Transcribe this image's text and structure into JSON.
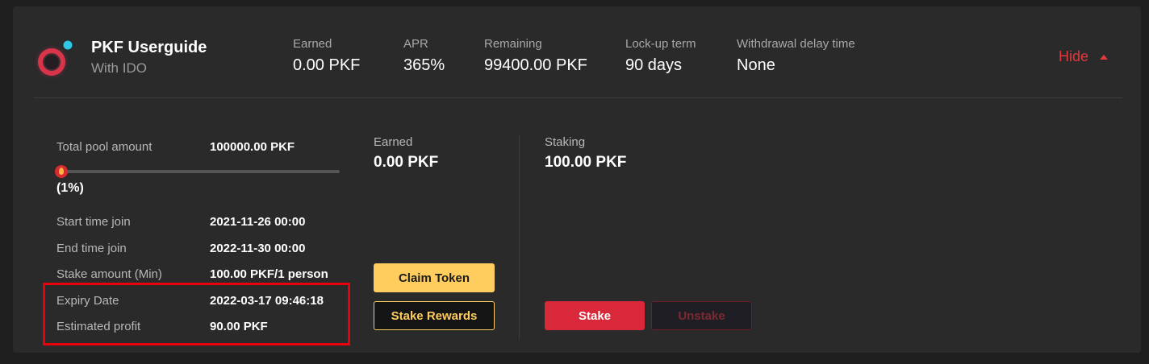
{
  "pool": {
    "name": "PKF Userguide",
    "subtitle": "With IDO",
    "colors": {
      "accent": "#e03a3e",
      "logo_ring": "#d8344a",
      "status_dot": "#2fc7e8",
      "gold": "#ffcd5e"
    }
  },
  "stats": [
    {
      "label": "Earned",
      "value": "0.00 PKF"
    },
    {
      "label": "APR",
      "value": "365%"
    },
    {
      "label": "Remaining",
      "value": "99400.00 PKF"
    },
    {
      "label": "Lock-up term",
      "value": "90 days"
    },
    {
      "label": "Withdrawal delay time",
      "value": "None"
    }
  ],
  "toggle": {
    "label": "Hide"
  },
  "details": {
    "total_pool_label": "Total pool amount",
    "total_pool_value": "100000.00 PKF",
    "progress_percent": 1,
    "progress_label": "(1%)",
    "rows": [
      {
        "label": "Start time join",
        "value": "2021-11-26 00:00"
      },
      {
        "label": "End time join",
        "value": "2022-11-30 00:00"
      },
      {
        "label": "Stake amount (Min)",
        "value": "100.00 PKF/1 person"
      },
      {
        "label": "Expiry Date",
        "value": "2022-03-17 09:46:18"
      },
      {
        "label": "Estimated profit",
        "value": "90.00 PKF"
      }
    ]
  },
  "earned_panel": {
    "label": "Earned",
    "value": "0.00 PKF",
    "claim_label": "Claim Token",
    "stake_rewards_label": "Stake Rewards"
  },
  "staking_panel": {
    "label": "Staking",
    "value": "100.00 PKF",
    "stake_label": "Stake",
    "unstake_label": "Unstake"
  }
}
